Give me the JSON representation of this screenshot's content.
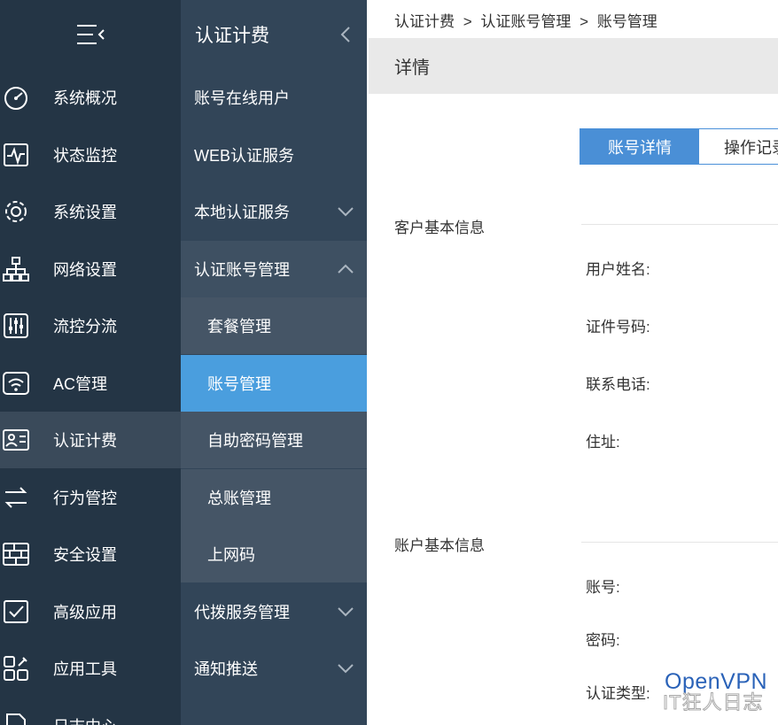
{
  "nav1": {
    "items": [
      {
        "label": "系统概况",
        "icon": "gauge-icon"
      },
      {
        "label": "状态监控",
        "icon": "monitor-pulse-icon"
      },
      {
        "label": "系统设置",
        "icon": "gear-icon"
      },
      {
        "label": "网络设置",
        "icon": "network-icon"
      },
      {
        "label": "流控分流",
        "icon": "sliders-icon"
      },
      {
        "label": "AC管理",
        "icon": "wifi-icon"
      },
      {
        "label": "认证计费",
        "icon": "id-card-icon",
        "active": true
      },
      {
        "label": "行为管控",
        "icon": "arrows-icon"
      },
      {
        "label": "安全设置",
        "icon": "brick-wall-icon"
      },
      {
        "label": "高级应用",
        "icon": "check-window-icon"
      },
      {
        "label": "应用工具",
        "icon": "tools-icon"
      },
      {
        "label": "日志中心",
        "icon": "document-icon"
      }
    ]
  },
  "nav2": {
    "title": "认证计费",
    "items": [
      {
        "label": "账号在线用户"
      },
      {
        "label": "WEB认证服务"
      },
      {
        "label": "本地认证服务",
        "chevron": "down"
      },
      {
        "label": "认证账号管理",
        "chevron": "up",
        "open": true
      },
      {
        "label": "套餐管理",
        "sub": true
      },
      {
        "label": "账号管理",
        "sub": true,
        "active": true
      },
      {
        "label": "自助密码管理",
        "sub": true
      },
      {
        "label": "总账管理",
        "sub": true
      },
      {
        "label": "上网码",
        "sub": true
      },
      {
        "label": "代拨服务管理",
        "chevron": "down"
      },
      {
        "label": "通知推送",
        "chevron": "down"
      }
    ]
  },
  "breadcrumb": {
    "items": [
      "认证计费",
      ">",
      "认证账号管理",
      ">",
      "账号管理"
    ]
  },
  "page_title": "详情",
  "tabs": [
    {
      "label": "账号详情",
      "active": true
    },
    {
      "label": "操作记录",
      "active": false
    }
  ],
  "customer_section": {
    "title": "客户基本信息",
    "fields": [
      "用户姓名:",
      "证件号码:",
      "联系电话:",
      "住址:"
    ]
  },
  "account_section": {
    "title": "账户基本信息",
    "fields": [
      "账号:",
      "密码:",
      "认证类型:"
    ]
  },
  "watermark": {
    "line1": "OpenVPN",
    "line2": "IT狂人日志"
  },
  "colors": {
    "sidebar": "#243545",
    "submenu": "#324558",
    "accent": "#4a9ede"
  }
}
